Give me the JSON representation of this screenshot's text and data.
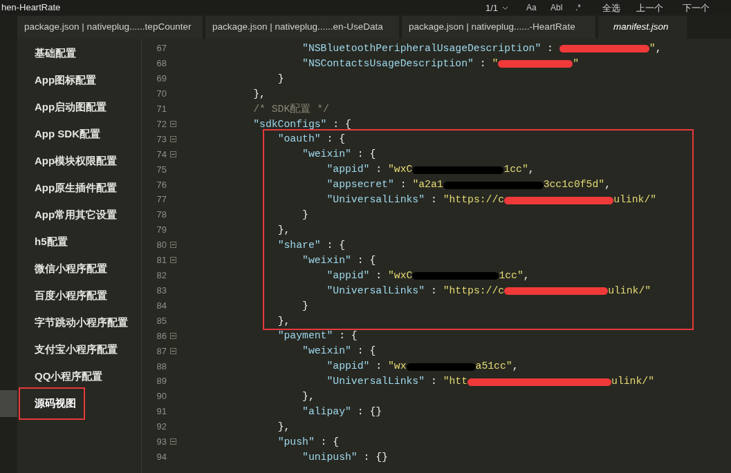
{
  "window": {
    "title": "hen-HeartRate"
  },
  "find_bar": {
    "count": "1/1",
    "options": [
      "Aa",
      "Abl",
      ".*"
    ],
    "actions": [
      "全选",
      "上一个",
      "下一个"
    ]
  },
  "tabs": [
    {
      "label": "package.json | nativeplug......tepCounter",
      "selected": false
    },
    {
      "label": "package.json | nativeplug......en-UseData",
      "selected": false
    },
    {
      "label": "package.json | nativeplug......-HeartRate",
      "selected": false
    },
    {
      "label": "manifest.json",
      "selected": true
    }
  ],
  "sidebar": {
    "items": [
      {
        "label": "基础配置",
        "selected": false
      },
      {
        "label": "App图标配置",
        "selected": false
      },
      {
        "label": "App启动图配置",
        "selected": false
      },
      {
        "label": "App SDK配置",
        "selected": false
      },
      {
        "label": "App模块权限配置",
        "selected": false
      },
      {
        "label": "App原生插件配置",
        "selected": false
      },
      {
        "label": "App常用其它设置",
        "selected": false
      },
      {
        "label": "h5配置",
        "selected": false
      },
      {
        "label": "微信小程序配置",
        "selected": false
      },
      {
        "label": "百度小程序配置",
        "selected": false
      },
      {
        "label": "字节跳动小程序配置",
        "selected": false
      },
      {
        "label": "支付宝小程序配置",
        "selected": false
      },
      {
        "label": "QQ小程序配置",
        "selected": false
      },
      {
        "label": "源码视图",
        "selected": true
      }
    ]
  },
  "editor": {
    "lines": [
      {
        "number": "67",
        "fold": false,
        "tokens": [
          {
            "kind": "key",
            "text": "\"NSBluetoothPeripheralUsageDescription\""
          },
          {
            "kind": "punct",
            "text": " : "
          },
          {
            "kind": "redact",
            "color": "#f03a3a"
          },
          {
            "kind": "value",
            "text": "\""
          },
          {
            "kind": "punct",
            "text": ","
          }
        ]
      },
      {
        "number": "68",
        "fold": false,
        "tokens": [
          {
            "kind": "key",
            "text": "\"NSContactsUsageDescription\""
          },
          {
            "kind": "punct",
            "text": " : "
          },
          {
            "kind": "value",
            "text": "\""
          },
          {
            "kind": "redact",
            "color": "#f03a3a"
          },
          {
            "kind": "value",
            "text": "\""
          }
        ]
      },
      {
        "number": "69",
        "fold": false,
        "tokens": [
          {
            "kind": "close",
            "text": "}"
          }
        ]
      },
      {
        "number": "70",
        "fold": false,
        "tokens": [
          {
            "kind": "close",
            "text": "},"
          }
        ]
      },
      {
        "number": "71",
        "fold": false,
        "tokens": [
          {
            "kind": "comment",
            "text": "/* SDK配置 */"
          }
        ]
      },
      {
        "number": "72",
        "fold": true,
        "tokens": [
          {
            "kind": "key",
            "text": "\"sdkConfigs\""
          },
          {
            "kind": "open",
            "text": " : {"
          }
        ]
      },
      {
        "number": "73",
        "fold": true,
        "tokens": [
          {
            "kind": "key",
            "text": "\"oauth\""
          },
          {
            "kind": "open",
            "text": " : {"
          }
        ]
      },
      {
        "number": "74",
        "fold": true,
        "tokens": [
          {
            "kind": "key",
            "text": "\"weixin\""
          },
          {
            "kind": "open",
            "text": " : {"
          }
        ]
      },
      {
        "number": "75",
        "fold": false,
        "tokens": [
          {
            "kind": "key",
            "text": "\"appid\""
          },
          {
            "kind": "punct",
            "text": " : "
          },
          {
            "kind": "value",
            "text": "\"wxC"
          },
          {
            "kind": "redact",
            "color": "#000000"
          },
          {
            "kind": "value",
            "text": "1cc\""
          },
          {
            "kind": "punct",
            "text": ","
          }
        ]
      },
      {
        "number": "76",
        "fold": false,
        "tokens": [
          {
            "kind": "key",
            "text": "\"appsecret\""
          },
          {
            "kind": "punct",
            "text": " : "
          },
          {
            "kind": "value",
            "text": "\"a2a1"
          },
          {
            "kind": "redact",
            "color": "#000000"
          },
          {
            "kind": "value",
            "text": "3cc1c0f5d\""
          },
          {
            "kind": "punct",
            "text": ","
          }
        ]
      },
      {
        "number": "77",
        "fold": false,
        "tokens": [
          {
            "kind": "key",
            "text": "\"UniversalLinks\""
          },
          {
            "kind": "punct",
            "text": " : "
          },
          {
            "kind": "value",
            "text": "\"https://c"
          },
          {
            "kind": "redact",
            "color": "#f03a3a"
          },
          {
            "kind": "value",
            "text": "ulink/\""
          }
        ]
      },
      {
        "number": "78",
        "fold": false,
        "tokens": [
          {
            "kind": "close",
            "text": "}"
          }
        ]
      },
      {
        "number": "79",
        "fold": false,
        "tokens": [
          {
            "kind": "close",
            "text": "},"
          }
        ]
      },
      {
        "number": "80",
        "fold": true,
        "tokens": [
          {
            "kind": "key",
            "text": "\"share\""
          },
          {
            "kind": "open",
            "text": " : {"
          }
        ]
      },
      {
        "number": "81",
        "fold": true,
        "tokens": [
          {
            "kind": "key",
            "text": "\"weixin\""
          },
          {
            "kind": "open",
            "text": " : {"
          }
        ]
      },
      {
        "number": "82",
        "fold": false,
        "tokens": [
          {
            "kind": "key",
            "text": "\"appid\""
          },
          {
            "kind": "punct",
            "text": " : "
          },
          {
            "kind": "value",
            "text": "\"wxC"
          },
          {
            "kind": "redact",
            "color": "#000000"
          },
          {
            "kind": "value",
            "text": "1cc\""
          },
          {
            "kind": "punct",
            "text": ","
          }
        ]
      },
      {
        "number": "83",
        "fold": false,
        "tokens": [
          {
            "kind": "key",
            "text": "\"UniversalLinks\""
          },
          {
            "kind": "punct",
            "text": " : "
          },
          {
            "kind": "value",
            "text": "\"https://c"
          },
          {
            "kind": "redact",
            "color": "#f03a3a"
          },
          {
            "kind": "value",
            "text": "ulink/\""
          }
        ]
      },
      {
        "number": "84",
        "fold": false,
        "tokens": [
          {
            "kind": "close",
            "text": "}"
          }
        ]
      },
      {
        "number": "85",
        "fold": false,
        "tokens": [
          {
            "kind": "close",
            "text": "},"
          }
        ]
      },
      {
        "number": "86",
        "fold": true,
        "tokens": [
          {
            "kind": "key",
            "text": "\"payment\""
          },
          {
            "kind": "open",
            "text": " : {"
          }
        ]
      },
      {
        "number": "87",
        "fold": true,
        "tokens": [
          {
            "kind": "key",
            "text": "\"weixin\""
          },
          {
            "kind": "open",
            "text": " : {"
          }
        ]
      },
      {
        "number": "88",
        "fold": false,
        "tokens": [
          {
            "kind": "key",
            "text": "\"appid\""
          },
          {
            "kind": "punct",
            "text": " : "
          },
          {
            "kind": "value",
            "text": "\"wx"
          },
          {
            "kind": "redact",
            "color": "#000000"
          },
          {
            "kind": "value",
            "text": "a51cc\""
          },
          {
            "kind": "punct",
            "text": ","
          }
        ]
      },
      {
        "number": "89",
        "fold": false,
        "tokens": [
          {
            "kind": "key",
            "text": "\"UniversalLinks\""
          },
          {
            "kind": "punct",
            "text": " : "
          },
          {
            "kind": "value",
            "text": "\"htt"
          },
          {
            "kind": "redact",
            "color": "#f03a3a"
          },
          {
            "kind": "value",
            "text": "ulink/\""
          }
        ]
      },
      {
        "number": "90",
        "fold": false,
        "tokens": [
          {
            "kind": "close",
            "text": "},"
          }
        ]
      },
      {
        "number": "91",
        "fold": false,
        "tokens": [
          {
            "kind": "key",
            "text": "\"alipay\""
          },
          {
            "kind": "punct",
            "text": " : {}"
          }
        ]
      },
      {
        "number": "92",
        "fold": false,
        "tokens": [
          {
            "kind": "close",
            "text": "},"
          }
        ]
      },
      {
        "number": "93",
        "fold": true,
        "tokens": [
          {
            "kind": "key",
            "text": "\"push\""
          },
          {
            "kind": "open",
            "text": " : {"
          }
        ]
      },
      {
        "number": "94",
        "fold": false,
        "tokens": [
          {
            "kind": "key",
            "text": "\"unipush\""
          },
          {
            "kind": "punct",
            "text": " : {}"
          }
        ]
      }
    ]
  }
}
